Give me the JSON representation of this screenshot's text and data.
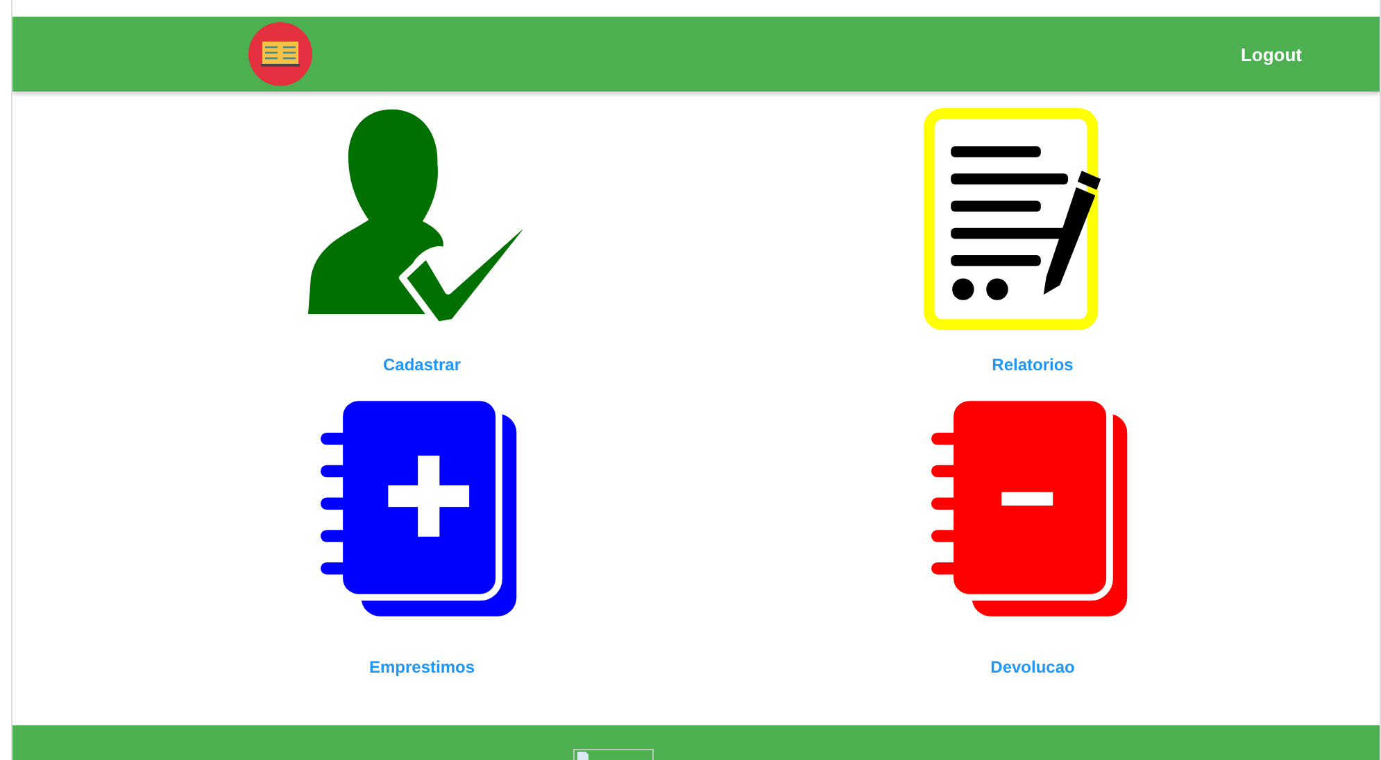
{
  "header": {
    "logout": "Logout"
  },
  "menu": [
    {
      "kind": "user-check",
      "label": "Cadastrar"
    },
    {
      "kind": "report",
      "label": "Relatorios"
    },
    {
      "kind": "notebook-plus",
      "label": "Emprestimos"
    },
    {
      "kind": "notebook-minus",
      "label": "Devolucao"
    }
  ]
}
